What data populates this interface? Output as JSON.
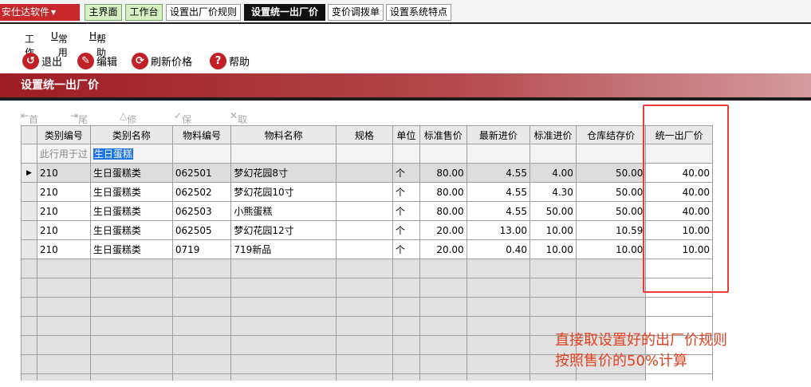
{
  "topbar": {
    "app_label": "安仕达软件",
    "tabs": [
      "主界面",
      "工作台",
      "设置出厂价规则",
      "设置统一出厂价",
      "变价调拨单",
      "设置系统特点"
    ]
  },
  "menu": [
    {
      "key": "",
      "label": "工作"
    },
    {
      "key": "U",
      "label": "常用"
    },
    {
      "key": "H",
      "label": "帮助"
    }
  ],
  "toolbar": {
    "exit": "退出",
    "edit": "编辑",
    "refresh": "刷新价格",
    "help": "帮助"
  },
  "title": "设置统一出厂价",
  "nav": [
    "首记录",
    "尾记录",
    "修改",
    "保存",
    "取消"
  ],
  "grid": {
    "columns": [
      "类别编号",
      "类别名称",
      "物料编号",
      "物料名称",
      "规格",
      "单位",
      "标准售价",
      "最新进价",
      "标准进价",
      "仓库结存价",
      "统一出厂价"
    ],
    "filter_hint": "此行用于过",
    "filter_value": "生日蛋糕",
    "rows": [
      [
        "210",
        "生日蛋糕类",
        "062501",
        "梦幻花园8寸",
        "",
        "个",
        "80.00",
        "4.55",
        "4.00",
        "50.00",
        "40.00"
      ],
      [
        "210",
        "生日蛋糕类",
        "062502",
        "梦幻花园10寸",
        "",
        "个",
        "80.00",
        "4.55",
        "4.30",
        "50.00",
        "40.00"
      ],
      [
        "210",
        "生日蛋糕类",
        "062503",
        "小熊蛋糕",
        "",
        "个",
        "80.00",
        "4.55",
        "50.00",
        "50.00",
        "40.00"
      ],
      [
        "210",
        "生日蛋糕类",
        "062505",
        "梦幻花园12寸",
        "",
        "个",
        "20.00",
        "13.00",
        "10.00",
        "10.59",
        "10.00"
      ],
      [
        "210",
        "生日蛋糕类",
        "0719",
        "719新品",
        "",
        "个",
        "20.00",
        "0.40",
        "10.00",
        "10.00",
        "10.00"
      ]
    ]
  },
  "annotation": {
    "line1": "直接取设置好的出厂价规则",
    "line2": "按照售价的50%计算"
  }
}
